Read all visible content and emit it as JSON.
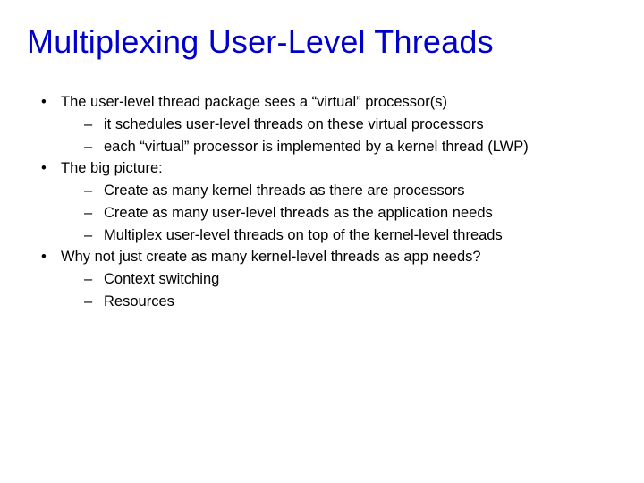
{
  "title": "Multiplexing User-Level Threads",
  "bullets": [
    {
      "text": "The user-level thread package sees a “virtual” processor(s)",
      "sub": [
        "it schedules user-level threads on these virtual processors",
        "each “virtual” processor is implemented by a kernel thread (LWP)"
      ]
    },
    {
      "text": "The big picture:",
      "sub": [
        "Create as many kernel threads as there are processors",
        "Create as many user-level threads as the application needs",
        "Multiplex user-level threads on top of the kernel-level threads"
      ]
    },
    {
      "text": "Why not just create as many kernel-level threads as app needs?",
      "sub": [
        "Context switching",
        "Resources"
      ]
    }
  ]
}
